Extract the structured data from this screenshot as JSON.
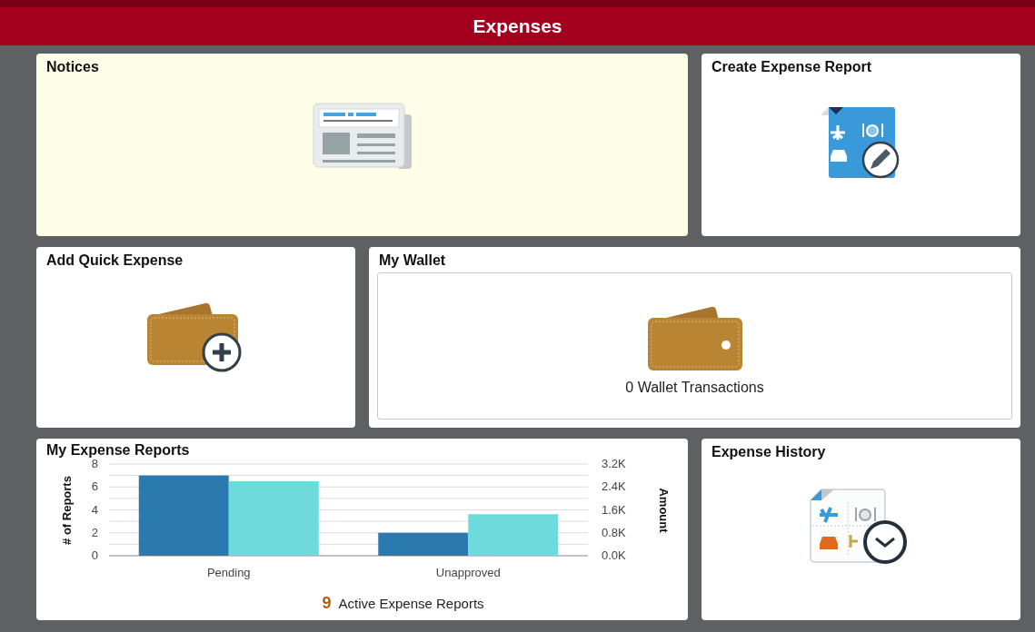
{
  "header": {
    "title": "Expenses"
  },
  "tiles": [
    {
      "kind": "notices",
      "title": "Notices",
      "highlighted": true
    },
    {
      "kind": "create",
      "title": "Create Expense Report",
      "highlighted": false
    },
    {
      "kind": "quick",
      "title": "Add Quick Expense",
      "highlighted": false
    },
    {
      "kind": "wallet",
      "title": "My Wallet",
      "highlighted": false,
      "summary": "0 Wallet Transactions"
    },
    {
      "kind": "reports",
      "title": "My Expense Reports",
      "highlighted": false,
      "count": "9",
      "count_label": "Active Expense Reports",
      "chart_data": {
        "type": "bar",
        "categories": [
          "Pending",
          "Unapproved"
        ],
        "ylabel": "# of Reports",
        "y2label": "Amount",
        "grid": true,
        "ylim": [
          0,
          8
        ],
        "yticks": [
          0,
          2,
          4,
          6,
          8
        ],
        "y2lim": [
          0,
          3200
        ],
        "y2ticks": [
          {
            "value": 0,
            "label": "0.0K"
          },
          {
            "value": 800,
            "label": "0.8K"
          },
          {
            "value": 1600,
            "label": "1.6K"
          },
          {
            "value": 2400,
            "label": "2.4K"
          },
          {
            "value": 3200,
            "label": "3.2K"
          }
        ],
        "series": [
          {
            "axis": "y",
            "color": "#2a7ab0",
            "values": [
              7,
              2
            ]
          },
          {
            "axis": "y2",
            "color": "#6ddbdb",
            "values": [
              2600,
              1450
            ]
          }
        ]
      }
    },
    {
      "kind": "history",
      "title": "Expense History",
      "highlighted": false
    }
  ]
}
